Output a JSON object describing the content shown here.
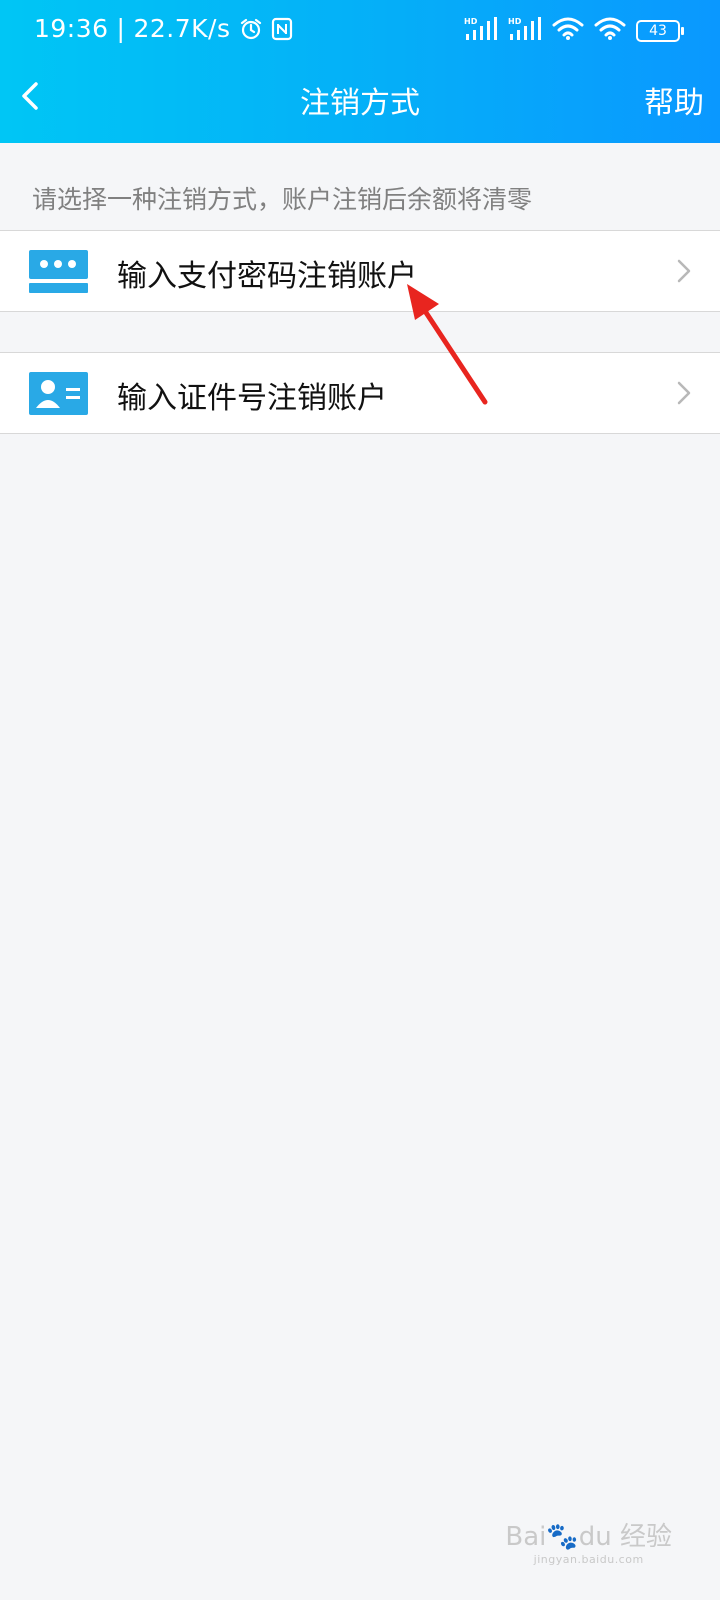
{
  "status_bar": {
    "time": "19:36",
    "speed": "22.7K/s",
    "battery": "43"
  },
  "nav": {
    "title": "注销方式",
    "help": "帮助"
  },
  "hint": "请选择一种注销方式，账户注销后余额将清零",
  "options": [
    {
      "label": "输入支付密码注销账户",
      "icon": "password-card-icon"
    },
    {
      "label": "输入证件号注销账户",
      "icon": "id-card-icon"
    }
  ],
  "watermark": {
    "brand": "Bai",
    "brand2": "du",
    "product": "经验",
    "url": "jingyan.baidu.com"
  },
  "colors": {
    "header_start": "#00c6f5",
    "header_end": "#0a98ff",
    "icon_blue": "#29a9e6",
    "annotation_red": "#e8251f"
  }
}
